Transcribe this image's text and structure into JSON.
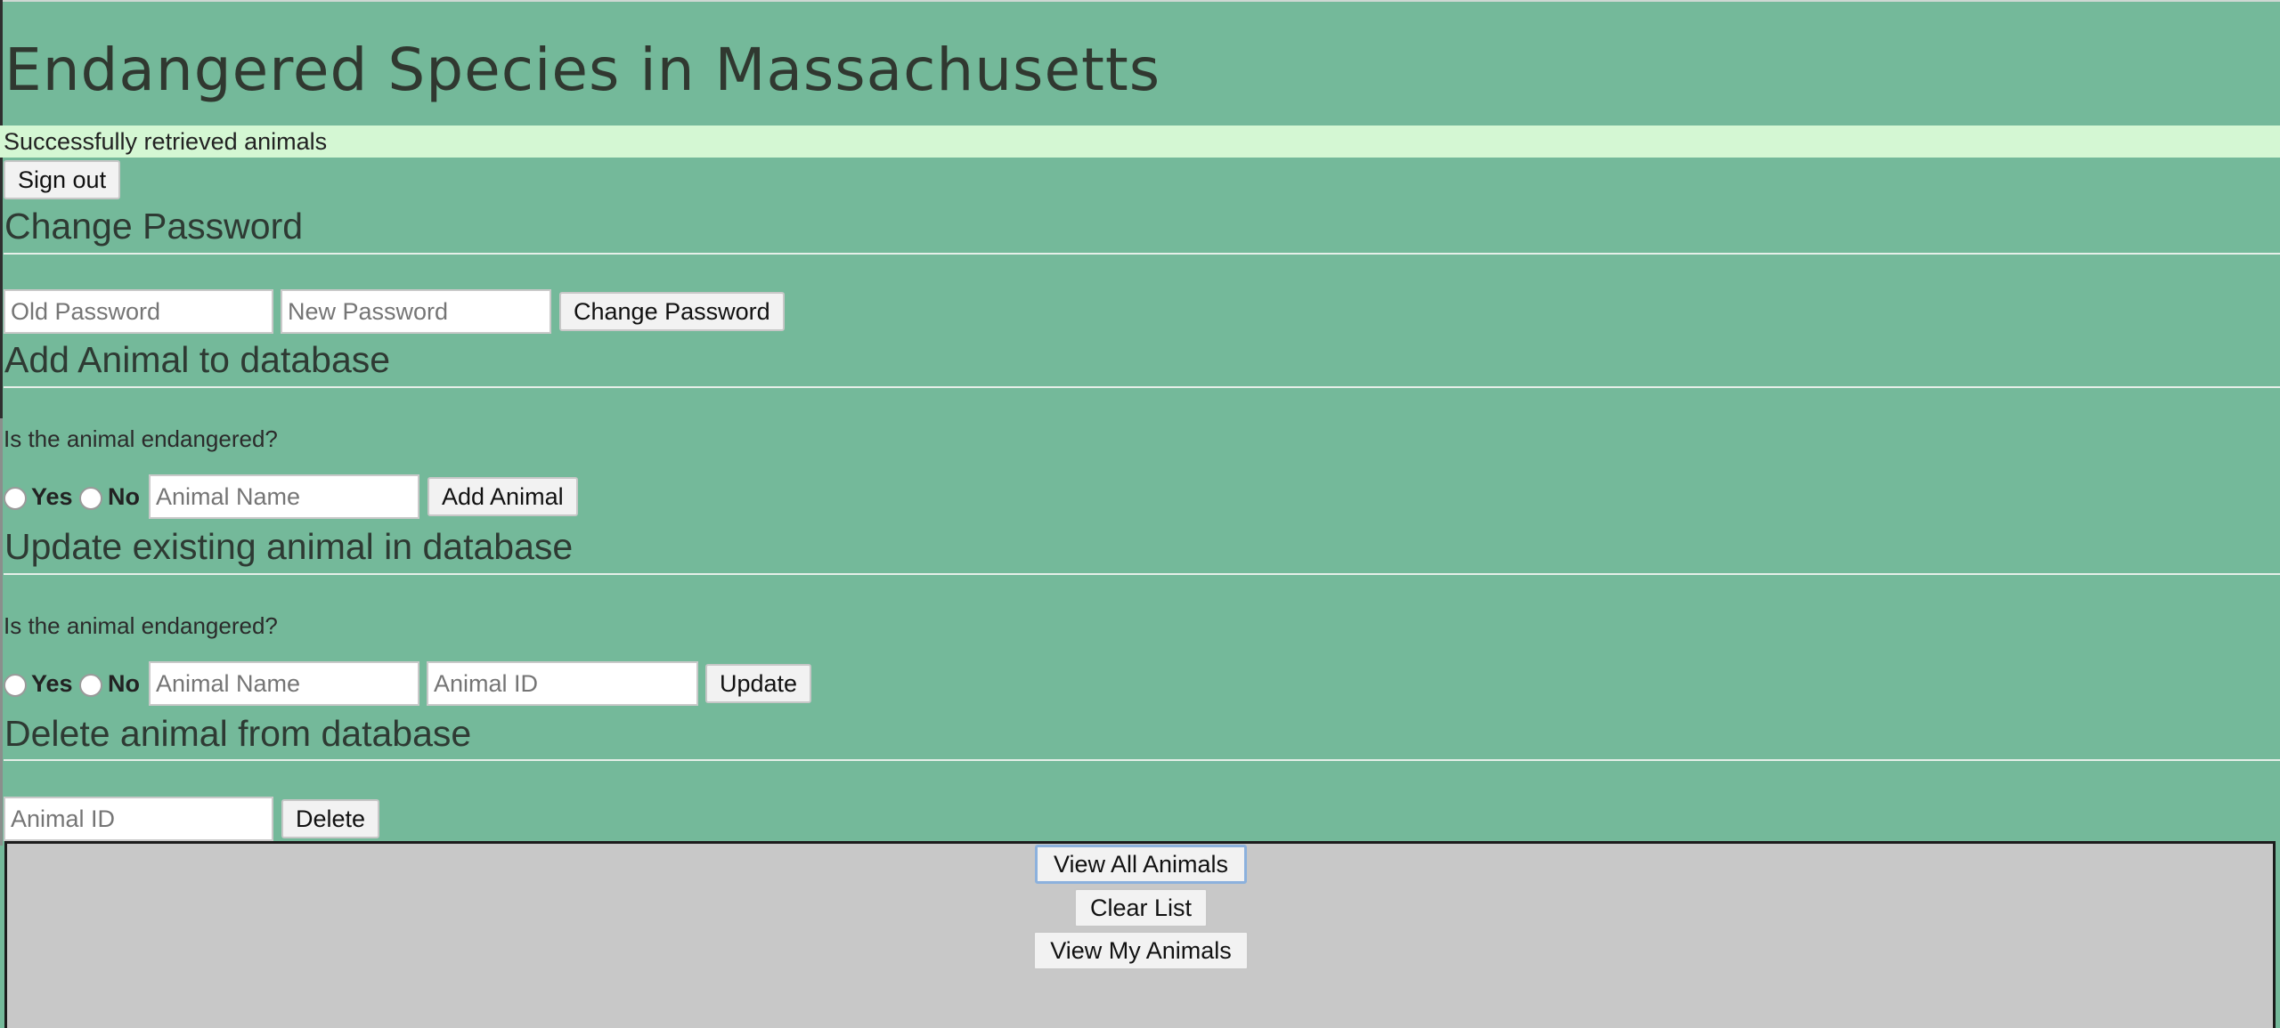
{
  "header": {
    "title": "Endangered Species in Massachusetts"
  },
  "status": {
    "message": "Successfully retrieved animals"
  },
  "auth": {
    "sign_out_label": "Sign out"
  },
  "change_password": {
    "heading": "Change Password",
    "old_password_placeholder": "Old Password",
    "new_password_placeholder": "New Password",
    "submit_label": "Change Password"
  },
  "add_animal": {
    "heading": "Add Animal to database",
    "question": "Is the animal endangered?",
    "yes_label": "Yes",
    "no_label": "No",
    "name_placeholder": "Animal Name",
    "submit_label": "Add Animal"
  },
  "update_animal": {
    "heading": "Update existing animal in database",
    "question": "Is the animal endangered?",
    "yes_label": "Yes",
    "no_label": "No",
    "name_placeholder": "Animal Name",
    "id_placeholder": "Animal ID",
    "submit_label": "Update"
  },
  "delete_animal": {
    "heading": "Delete animal from database",
    "id_placeholder": "Animal ID",
    "submit_label": "Delete"
  },
  "list_controls": {
    "view_all_label": "View All Animals",
    "clear_label": "Clear List",
    "view_mine_label": "View My Animals"
  },
  "colors": {
    "page_background": "#74b99a",
    "status_background": "#d4f7d3",
    "list_background": "#c8c8c8",
    "focus_ring": "#8cb1dd"
  }
}
